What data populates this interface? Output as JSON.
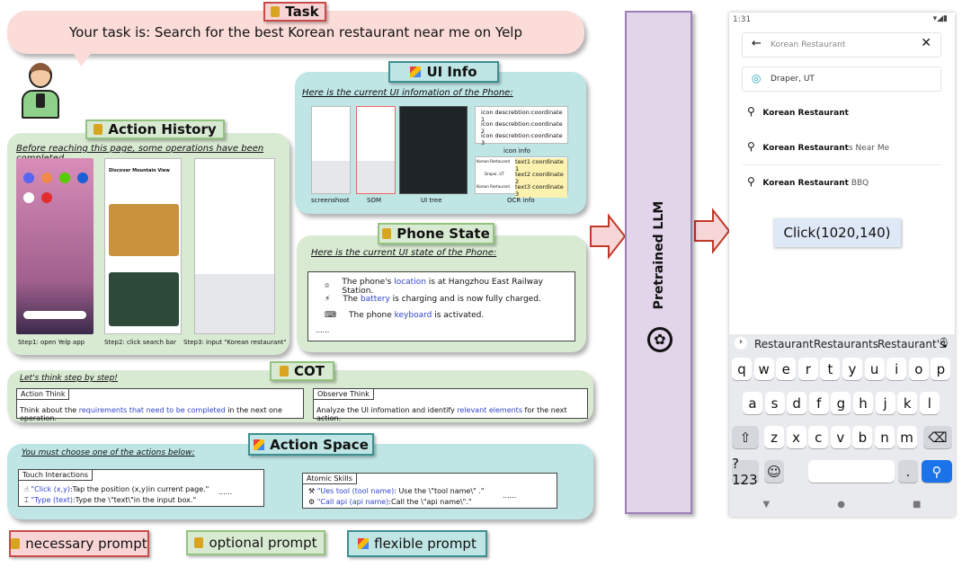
{
  "task": {
    "label": "Task",
    "text": "Your task is: Search for the best Korean restaurant near me on Yelp"
  },
  "action_history": {
    "label": "Action History",
    "intro": "Before reaching this page, some operations have been completed.",
    "phone2_title": "Discover Mountain View",
    "steps": [
      "Step1:  open Yelp app",
      "Step2:  click search bar",
      "Step3:  input \"Korean restaurant\""
    ]
  },
  "ui_info": {
    "label": "UI Info",
    "intro": "Here is  the current UI  infomation of  the Phone:",
    "captions": [
      "screenshoot",
      "SOM",
      "UI tree",
      "OCR info"
    ],
    "icon_info_label": "icon info",
    "icon_rows": [
      "icon descrebtion:coordinate 1",
      "icon descrebtion:coordinate 2",
      "icon descrebtion:coordinate 3"
    ],
    "ocr_rows": [
      {
        "src": "Korean Restaurant",
        "text": "text1 coordinate 1"
      },
      {
        "src": "Draper, UT",
        "text": "text2 coordinate 2"
      },
      {
        "src": "Korean Restaurant",
        "text": "text3 coordinate 3"
      }
    ]
  },
  "phone_state": {
    "label": "Phone State",
    "intro": "Here is  the current UI  state of  the Phone:",
    "items": [
      {
        "pre": "The phone's ",
        "hl": "location",
        "post": " is at Hangzhou East Railway Station.",
        "icon": "location-pin-icon"
      },
      {
        "pre": "The ",
        "hl": "battery",
        "post": " is charging and is now fully charged.",
        "icon": "battery-charging-icon"
      },
      {
        "pre": "The phone ",
        "hl": "keyboard",
        "post": " is activated.",
        "icon": "keyboard-icon"
      }
    ],
    "ellipsis": "......"
  },
  "cot": {
    "label": "COT",
    "intro": "Let's think step by step!",
    "action_think": {
      "title": "Action Think",
      "pre": "Think about the ",
      "hl": "requirements that need to be completed",
      "post": " in the next one operation."
    },
    "observe_think": {
      "title": "Observe Think",
      "pre": "Analyze the UI infomation and identify ",
      "hl": "relevant elements",
      "post": " for the next action."
    }
  },
  "action_space": {
    "label": "Action Space",
    "intro": "You must choose one of the actions below:",
    "touch": {
      "title": "Touch Interactions",
      "items": [
        {
          "hl": "\"Click (x,y)",
          "post": ":Tap the position (x,y)in current page.\""
        },
        {
          "hl": "\"Type (text)",
          "post": ":Type the \\\"text\\\"in the input box.\""
        }
      ],
      "ellipsis": "......"
    },
    "atomic": {
      "title": "Atomic Skills",
      "items": [
        {
          "hl": "\"Ues tool (tool name)",
          "post": ": Use the  \\\"tool name\\\" .\""
        },
        {
          "hl": "\"Call api (api name)",
          "post": ":Call the \\\"api name\\\".\""
        }
      ],
      "ellipsis": "......"
    }
  },
  "legend": {
    "necessary": "necessary prompt",
    "optional": "optional prompt",
    "flexible": "flexible prompt"
  },
  "llm": {
    "label": "Pretrained LLM"
  },
  "phone": {
    "time": "1:31",
    "search_value": "Korean Restaurant",
    "location": "Draper, UT",
    "suggestions": [
      {
        "bold": "Korean Restaurant",
        "rest": ""
      },
      {
        "bold": "Korean Restaurant",
        "rest": "s Near Me"
      },
      {
        "bold": "Korean Restaurant",
        "rest": " BBQ"
      }
    ],
    "action": "Click(1020,140)",
    "kb_suggestions": [
      "Restaurant",
      "Restaurants",
      "Restaurant's"
    ],
    "rows": [
      [
        "q",
        "w",
        "e",
        "r",
        "t",
        "y",
        "u",
        "i",
        "o",
        "p"
      ],
      [
        "a",
        "s",
        "d",
        "f",
        "g",
        "h",
        "j",
        "k",
        "l"
      ],
      [
        "z",
        "x",
        "c",
        "v",
        "b",
        "n",
        "m"
      ]
    ],
    "sym": "?123"
  },
  "colors": {
    "green_panel": "#d9ead3",
    "cyan_panel": "#bfe5e5",
    "pink_panel": "#fbdcd8",
    "llm": "#e2d5ea",
    "accent_blue": "#1a73e8"
  }
}
